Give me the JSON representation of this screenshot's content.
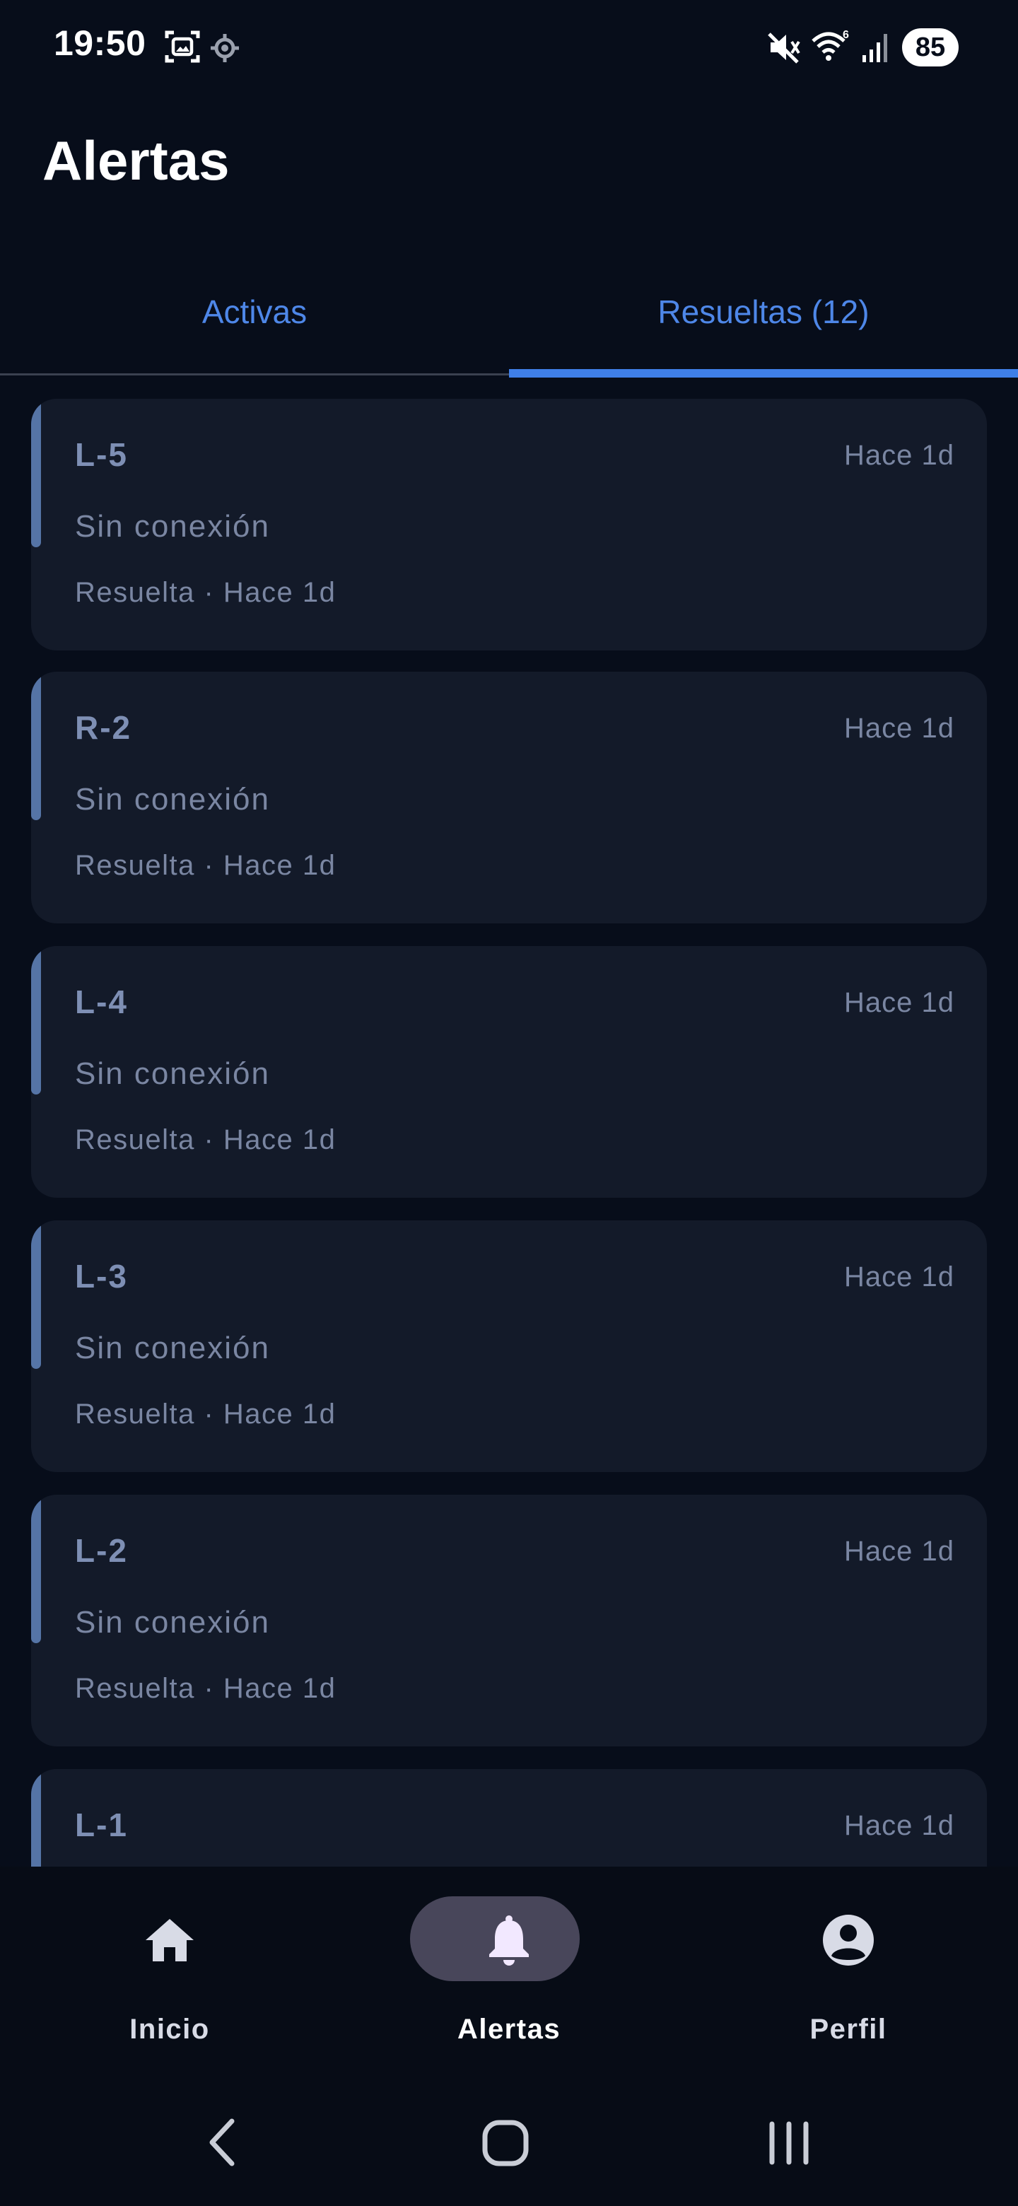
{
  "status_bar": {
    "time": "19:50",
    "battery": "85",
    "icons": [
      "screenshot-icon",
      "location-icon",
      "mute-icon",
      "wifi-icon",
      "signal-icon"
    ]
  },
  "page": {
    "title": "Alertas"
  },
  "tabs": [
    {
      "label": "Activas",
      "selected": false
    },
    {
      "label": "Resueltas (12)",
      "selected": true
    }
  ],
  "alerts": [
    {
      "title": "L-5",
      "time": "Hace 1d",
      "message": "Sin conexión",
      "status": "Resuelta · Hace 1d"
    },
    {
      "title": "R-2",
      "time": "Hace 1d",
      "message": "Sin conexión",
      "status": "Resuelta · Hace 1d"
    },
    {
      "title": "L-4",
      "time": "Hace 1d",
      "message": "Sin conexión",
      "status": "Resuelta · Hace 1d"
    },
    {
      "title": "L-3",
      "time": "Hace 1d",
      "message": "Sin conexión",
      "status": "Resuelta · Hace 1d"
    },
    {
      "title": "L-2",
      "time": "Hace 1d",
      "message": "Sin conexión",
      "status": "Resuelta · Hace 1d"
    },
    {
      "title": "L-1",
      "time": "Hace 1d"
    }
  ],
  "bottom_nav": [
    {
      "label": "Inicio",
      "icon": "home-icon",
      "active": false
    },
    {
      "label": "Alertas",
      "icon": "bell-icon",
      "active": true
    },
    {
      "label": "Perfil",
      "icon": "profile-icon",
      "active": false
    }
  ],
  "colors": {
    "background": "#070d1a",
    "card": "#131a29",
    "accent": "#3f7fe8",
    "card_accent_bar": "#5574a6",
    "muted_text": "#7a86a2",
    "active_pill": "#48465a"
  }
}
